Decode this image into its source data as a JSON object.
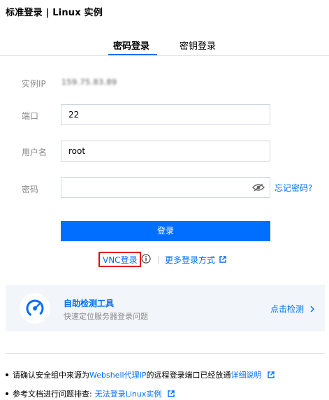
{
  "header": {
    "title": "标准登录 | Linux 实例"
  },
  "tabs": {
    "password": "密码登录",
    "key": "密钥登录"
  },
  "form": {
    "ip_label": "实例IP",
    "ip_value": "159.75.83.89",
    "port_label": "端口",
    "port_value": "22",
    "user_label": "用户名",
    "user_value": "root",
    "password_label": "密码",
    "password_value": "",
    "forgot_label": "忘记密码?"
  },
  "login_button": "登录",
  "alt_login": {
    "vnc": "VNC登录",
    "more": "更多登录方式"
  },
  "tool": {
    "title": "自助检测工具",
    "subtitle": "快速定位服务器登录问题",
    "action": "点击检测"
  },
  "notes": {
    "line1_a": "请确认安全组中来源为",
    "line1_link1": "Webshell代理IP",
    "line1_b": "的远程登录端口已经放通",
    "line1_link2": "详细说明",
    "line2_a": "参考文档进行问题排查:",
    "line2_link": "无法登录Linux实例"
  },
  "colors": {
    "accent": "#006eff",
    "highlight_border": "#e60000",
    "card_bg": "#f2f5fa",
    "label_gray": "#888888"
  },
  "icons": [
    "eye-hidden-icon",
    "info-icon",
    "external-link-icon",
    "gauge-icon",
    "chevron-right-icon"
  ]
}
